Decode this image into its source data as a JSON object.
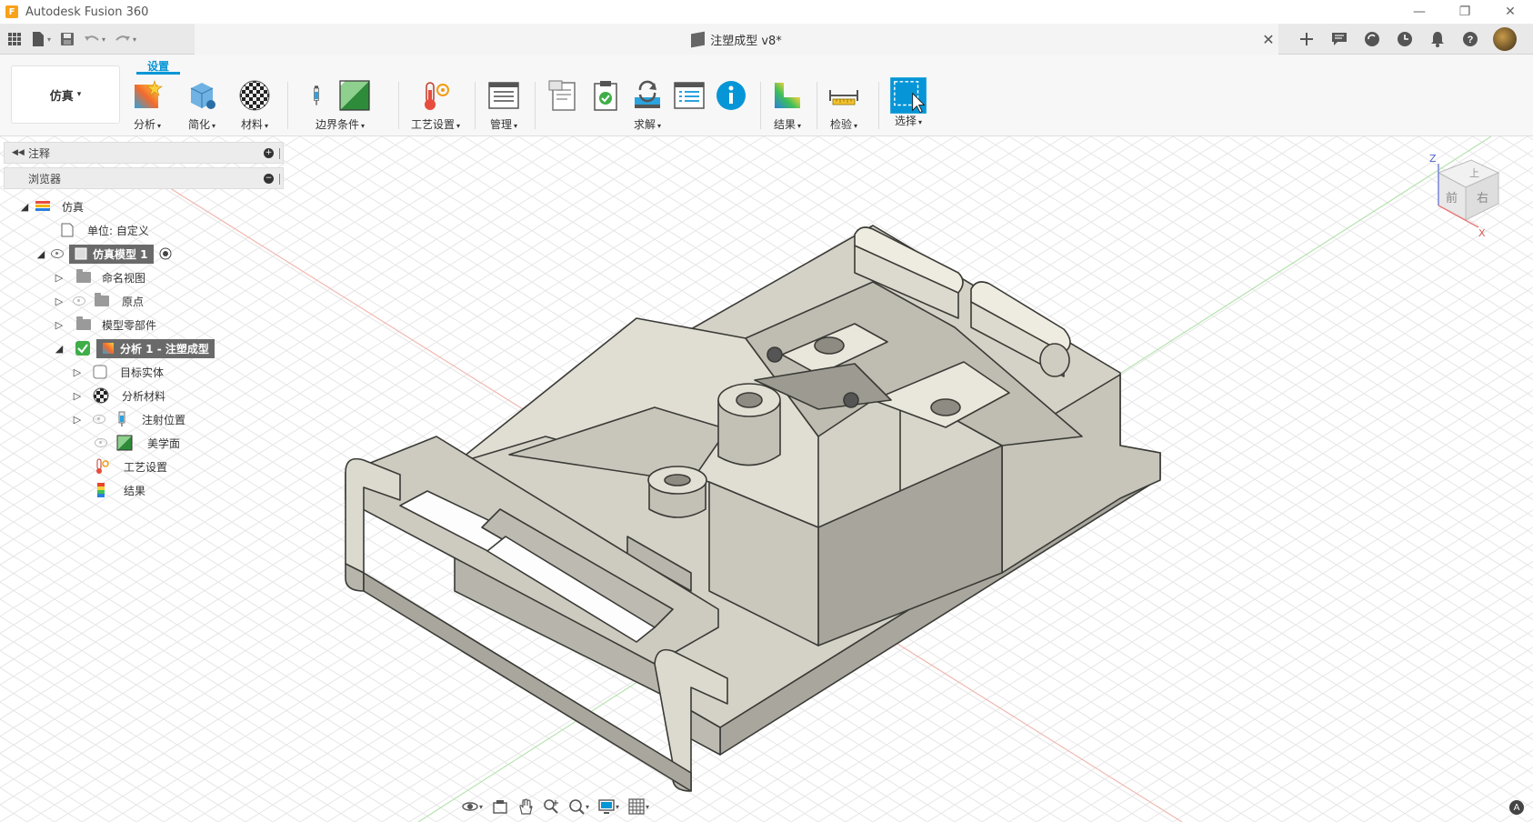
{
  "app": {
    "title": "Autodesk Fusion 360",
    "logo_letter": "F"
  },
  "window_controls": {
    "minimize": "—",
    "restore": "❐",
    "close": "✕"
  },
  "document_tab": {
    "title": "注塑成型 v8*",
    "close": "✕"
  },
  "workspace": {
    "label": "仿真",
    "caret": "▾"
  },
  "ribbon": {
    "active_tab": "设置",
    "groups": [
      {
        "label": "分析"
      },
      {
        "label": "简化"
      },
      {
        "label": "材料"
      },
      {
        "label": "边界条件"
      },
      {
        "label": "工艺设置"
      },
      {
        "label": "管理"
      },
      {
        "label": "求解"
      },
      {
        "label": "结果"
      },
      {
        "label": "检验"
      },
      {
        "label": "选择"
      }
    ]
  },
  "panels": {
    "comments": "注释",
    "browser": "浏览器"
  },
  "tree": {
    "root": "仿真",
    "units": "单位: 自定义",
    "model": "仿真模型 1",
    "named_views": "命名视图",
    "origin": "原点",
    "model_components": "模型零部件",
    "analysis": "分析 1 - 注塑成型",
    "target_body": "目标实体",
    "analysis_material": "分析材料",
    "injection_location": "注射位置",
    "aesthetic_faces": "美学面",
    "process_settings": "工艺设置",
    "results": "结果"
  },
  "viewcube": {
    "top": "上",
    "front": "前",
    "right": "右",
    "axis_z": "Z",
    "axis_x": "X"
  },
  "colors": {
    "accent": "#0696d7",
    "model_fill": "#cfcdc2",
    "model_edge": "#3a3a36",
    "grid": "#e4e4e4"
  }
}
